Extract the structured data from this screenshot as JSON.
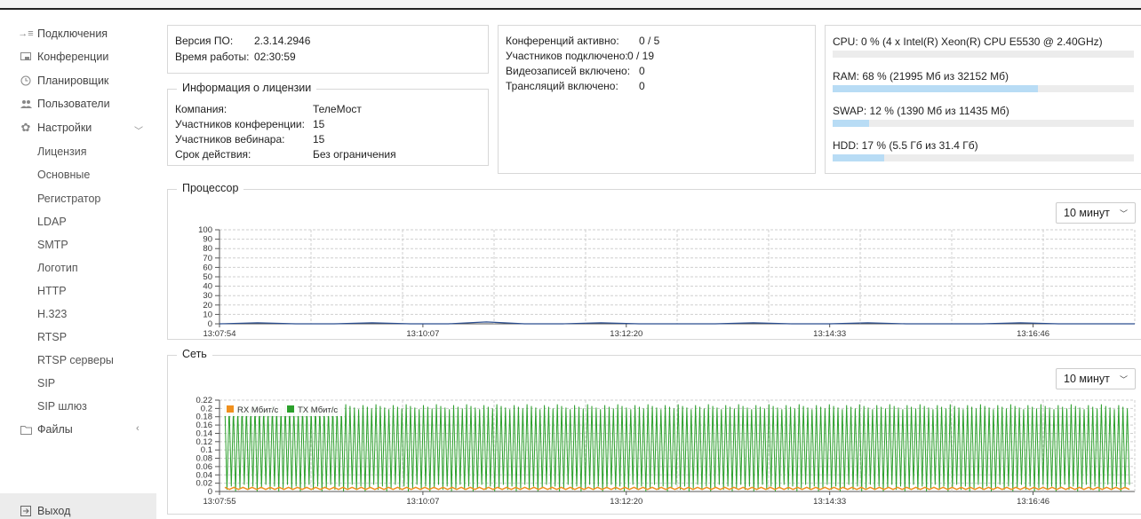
{
  "sidebar": {
    "items": [
      {
        "label": "Подключения",
        "icon": "connections-icon"
      },
      {
        "label": "Конференции",
        "icon": "conferences-icon"
      },
      {
        "label": "Планировщик",
        "icon": "clock-icon"
      },
      {
        "label": "Пользователи",
        "icon": "users-icon"
      },
      {
        "label": "Настройки",
        "icon": "gear-icon"
      }
    ],
    "settings_sub": [
      "Лицензия",
      "Основные",
      "Регистратор",
      "LDAP",
      "SMTP",
      "Логотип",
      "HTTP",
      "H.323",
      "RTSP",
      "RTSP серверы",
      "SIP",
      "SIP шлюз"
    ],
    "files_label": "Файлы",
    "logout_label": "Выход"
  },
  "version": {
    "label": "Версия ПО:",
    "value": "2.3.14.2946"
  },
  "uptime": {
    "label": "Время работы:",
    "value": "02:30:59"
  },
  "license": {
    "title": "Информация о лицензии",
    "rows": [
      {
        "label": "Компания:",
        "value": "ТелеМост"
      },
      {
        "label": "Участников конференции:",
        "value": "15"
      },
      {
        "label": "Участников вебинара:",
        "value": "15"
      },
      {
        "label": "Срок действия:",
        "value": "Без ограничения"
      }
    ]
  },
  "stats": [
    {
      "label": "Конференций активно:",
      "value": "0 / 5"
    },
    {
      "label": "Участников подключено:",
      "value": "0 / 19"
    },
    {
      "label": "Видеозаписей включено:",
      "value": "0"
    },
    {
      "label": "Трансляций включено:",
      "value": "0"
    }
  ],
  "resources": [
    {
      "text": "CPU:  0 % (4 x Intel(R) Xeon(R) CPU E5530 @ 2.40GHz)",
      "percent": 0
    },
    {
      "text": "RAM:  68 % (21995 Мб из 32152 Мб)",
      "percent": 68
    },
    {
      "text": "SWAP:  12 % (1390 Мб из 11435 Мб)",
      "percent": 12
    },
    {
      "text": "HDD:  17 % (5.5 Гб из 31.4 Гб)",
      "percent": 17
    }
  ],
  "colors": {
    "bar_fill": "#b8dcf5",
    "rx": "#f0901e",
    "tx": "#2ca02c",
    "cpu_line": "#2a4d8f"
  },
  "cpu_panel": {
    "title": "Процессор",
    "range": "10 минут"
  },
  "net_panel": {
    "title": "Сеть",
    "range": "10 минут"
  },
  "chart_data": [
    {
      "type": "line",
      "title": "Процессор",
      "y_ticks": [
        "0",
        "10",
        "20",
        "30",
        "40",
        "50",
        "60",
        "70",
        "80",
        "90",
        "100"
      ],
      "ylim": [
        0,
        100
      ],
      "x_ticks": [
        "13:07:54",
        "13:10:07",
        "13:12:20",
        "13:14:33",
        "13:16:46"
      ],
      "series": [
        {
          "values": [
            0,
            1,
            0,
            0,
            1,
            0,
            0,
            2,
            0,
            0,
            1,
            0,
            0,
            0,
            1,
            0,
            0,
            1,
            0,
            0,
            0,
            1,
            0,
            0,
            0
          ]
        }
      ],
      "grid": true
    },
    {
      "type": "line",
      "title": "Сеть",
      "y_ticks": [
        "0",
        "0.02",
        "0.04",
        "0.06",
        "0.08",
        "0.1",
        "0.12",
        "0.14",
        "0.16",
        "0.18",
        "0.2",
        "0.22"
      ],
      "ylim": [
        0,
        0.22
      ],
      "x_ticks": [
        "13:07:55",
        "13:10:07",
        "13:12:20",
        "13:14:33",
        "13:16:46"
      ],
      "series": [
        {
          "name": "RX Мбит/с",
          "values_range": [
            0.005,
            0.01
          ]
        },
        {
          "name": "TX Мбит/с",
          "values_range": [
            0,
            0.21
          ]
        }
      ],
      "legend": "top-left",
      "grid": true
    }
  ]
}
